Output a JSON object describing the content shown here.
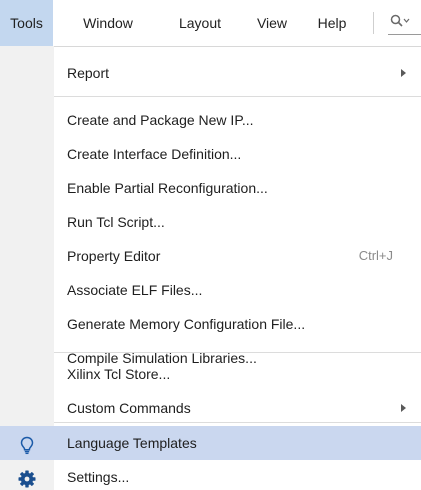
{
  "menubar": {
    "items": [
      {
        "label": "Tools",
        "active": true
      },
      {
        "label": "Window",
        "active": false
      },
      {
        "label": "Layout",
        "active": false
      },
      {
        "label": "View",
        "active": false
      },
      {
        "label": "Help",
        "active": false
      }
    ],
    "quick_search_icon": "search-icon"
  },
  "tools_menu": {
    "groups": [
      [
        {
          "label": "Report",
          "submenu": true
        }
      ],
      [
        {
          "label": "Create and Package New IP..."
        },
        {
          "label": "Create Interface Definition..."
        },
        {
          "label": "Enable Partial Reconfiguration..."
        },
        {
          "label": "Run Tcl Script..."
        },
        {
          "label": "Property Editor",
          "shortcut": "Ctrl+J"
        },
        {
          "label": "Associate ELF Files..."
        },
        {
          "label": "Generate Memory Configuration File..."
        },
        {
          "label": "Compile Simulation Libraries..."
        }
      ],
      [
        {
          "label": "Xilinx Tcl Store..."
        },
        {
          "label": "Custom Commands",
          "submenu": true
        }
      ],
      [
        {
          "label": "Language Templates",
          "icon": "lightbulb-icon",
          "highlighted": true
        },
        {
          "label": "Settings...",
          "icon": "gear-icon"
        }
      ]
    ]
  },
  "colors": {
    "active_menu_bg": "#c3d7ef",
    "highlight_bg": "#cad7ef",
    "gutter_bg": "#f1f1f1",
    "icon_blue": "#1b5aa8"
  }
}
